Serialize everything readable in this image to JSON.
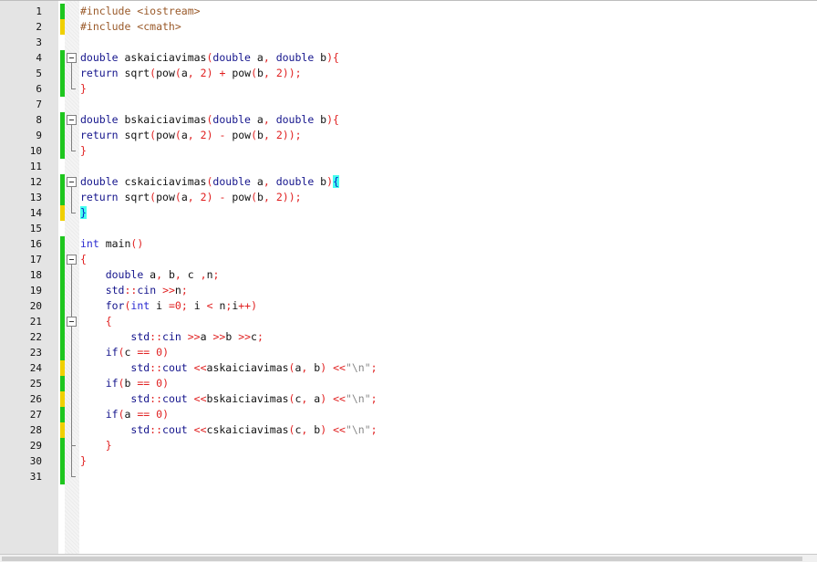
{
  "editor": {
    "lines": [
      {
        "n": "1",
        "change": "green",
        "fold": "none",
        "tokens": [
          [
            "pre",
            "#include <iostream>"
          ]
        ]
      },
      {
        "n": "2",
        "change": "yellow",
        "fold": "none",
        "tokens": [
          [
            "pre",
            "#include <cmath>"
          ]
        ]
      },
      {
        "n": "3",
        "change": "none",
        "fold": "none",
        "tokens": []
      },
      {
        "n": "4",
        "change": "green",
        "fold": "start",
        "tokens": [
          [
            "kw",
            "double"
          ],
          [
            "id",
            " askaiciavimas"
          ],
          [
            "op",
            "("
          ],
          [
            "kw",
            "double"
          ],
          [
            "id",
            " a"
          ],
          [
            "op",
            ","
          ],
          [
            "id",
            " "
          ],
          [
            "kw",
            "double"
          ],
          [
            "id",
            " b"
          ],
          [
            "op",
            "){"
          ]
        ]
      },
      {
        "n": "5",
        "change": "green",
        "fold": "line",
        "tokens": [
          [
            "kw",
            "return"
          ],
          [
            "id",
            " sqrt"
          ],
          [
            "op",
            "("
          ],
          [
            "id",
            "pow"
          ],
          [
            "op",
            "("
          ],
          [
            "id",
            "a"
          ],
          [
            "op",
            ","
          ],
          [
            "id",
            " "
          ],
          [
            "num",
            "2"
          ],
          [
            "op",
            ")"
          ],
          [
            "id",
            " "
          ],
          [
            "op",
            "+"
          ],
          [
            "id",
            " pow"
          ],
          [
            "op",
            "("
          ],
          [
            "id",
            "b"
          ],
          [
            "op",
            ","
          ],
          [
            "id",
            " "
          ],
          [
            "num",
            "2"
          ],
          [
            "op",
            "));"
          ]
        ]
      },
      {
        "n": "6",
        "change": "green",
        "fold": "end",
        "tokens": [
          [
            "op",
            "}"
          ]
        ]
      },
      {
        "n": "7",
        "change": "none",
        "fold": "none",
        "tokens": []
      },
      {
        "n": "8",
        "change": "green",
        "fold": "start",
        "tokens": [
          [
            "kw",
            "double"
          ],
          [
            "id",
            " bskaiciavimas"
          ],
          [
            "op",
            "("
          ],
          [
            "kw",
            "double"
          ],
          [
            "id",
            " a"
          ],
          [
            "op",
            ","
          ],
          [
            "id",
            " "
          ],
          [
            "kw",
            "double"
          ],
          [
            "id",
            " b"
          ],
          [
            "op",
            "){"
          ]
        ]
      },
      {
        "n": "9",
        "change": "green",
        "fold": "line",
        "tokens": [
          [
            "kw",
            "return"
          ],
          [
            "id",
            " sqrt"
          ],
          [
            "op",
            "("
          ],
          [
            "id",
            "pow"
          ],
          [
            "op",
            "("
          ],
          [
            "id",
            "a"
          ],
          [
            "op",
            ","
          ],
          [
            "id",
            " "
          ],
          [
            "num",
            "2"
          ],
          [
            "op",
            ")"
          ],
          [
            "id",
            " "
          ],
          [
            "op",
            "-"
          ],
          [
            "id",
            " pow"
          ],
          [
            "op",
            "("
          ],
          [
            "id",
            "b"
          ],
          [
            "op",
            ","
          ],
          [
            "id",
            " "
          ],
          [
            "num",
            "2"
          ],
          [
            "op",
            "));"
          ]
        ]
      },
      {
        "n": "10",
        "change": "green",
        "fold": "end",
        "tokens": [
          [
            "op",
            "}"
          ]
        ]
      },
      {
        "n": "11",
        "change": "none",
        "fold": "none",
        "tokens": []
      },
      {
        "n": "12",
        "change": "green",
        "fold": "start",
        "tokens": [
          [
            "kw",
            "double"
          ],
          [
            "id",
            " cskaiciavimas"
          ],
          [
            "op",
            "("
          ],
          [
            "kw",
            "double"
          ],
          [
            "id",
            " a"
          ],
          [
            "op",
            ","
          ],
          [
            "id",
            " "
          ],
          [
            "kw",
            "double"
          ],
          [
            "id",
            " b"
          ],
          [
            "op",
            ")"
          ],
          [
            "hl",
            "{"
          ]
        ]
      },
      {
        "n": "13",
        "change": "green",
        "fold": "line",
        "tokens": [
          [
            "kw",
            "return"
          ],
          [
            "id",
            " sqrt"
          ],
          [
            "op",
            "("
          ],
          [
            "id",
            "pow"
          ],
          [
            "op",
            "("
          ],
          [
            "id",
            "a"
          ],
          [
            "op",
            ","
          ],
          [
            "id",
            " "
          ],
          [
            "num",
            "2"
          ],
          [
            "op",
            ")"
          ],
          [
            "id",
            " "
          ],
          [
            "op",
            "-"
          ],
          [
            "id",
            " pow"
          ],
          [
            "op",
            "("
          ],
          [
            "id",
            "b"
          ],
          [
            "op",
            ","
          ],
          [
            "id",
            " "
          ],
          [
            "num",
            "2"
          ],
          [
            "op",
            "));"
          ]
        ]
      },
      {
        "n": "14",
        "change": "yellow",
        "fold": "end",
        "tokens": [
          [
            "hl",
            "}"
          ]
        ]
      },
      {
        "n": "15",
        "change": "none",
        "fold": "none",
        "tokens": []
      },
      {
        "n": "16",
        "change": "green",
        "fold": "none",
        "tokens": [
          [
            "tp",
            "int"
          ],
          [
            "id",
            " main"
          ],
          [
            "op",
            "()"
          ]
        ]
      },
      {
        "n": "17",
        "change": "green",
        "fold": "start",
        "tokens": [
          [
            "op",
            "{"
          ]
        ]
      },
      {
        "n": "18",
        "change": "green",
        "fold": "line",
        "tokens": [
          [
            "id",
            "    "
          ],
          [
            "kw",
            "double"
          ],
          [
            "id",
            " a"
          ],
          [
            "op",
            ","
          ],
          [
            "id",
            " b"
          ],
          [
            "op",
            ","
          ],
          [
            "id",
            " c "
          ],
          [
            "op",
            ","
          ],
          [
            "id",
            "n"
          ],
          [
            "op",
            ";"
          ]
        ]
      },
      {
        "n": "19",
        "change": "green",
        "fold": "line",
        "tokens": [
          [
            "id",
            "    "
          ],
          [
            "kw",
            "std"
          ],
          [
            "op",
            "::"
          ],
          [
            "kw",
            "cin"
          ],
          [
            "id",
            " "
          ],
          [
            "op",
            ">>"
          ],
          [
            "id",
            "n"
          ],
          [
            "op",
            ";"
          ]
        ]
      },
      {
        "n": "20",
        "change": "green",
        "fold": "line",
        "tokens": [
          [
            "id",
            "    "
          ],
          [
            "kw",
            "for"
          ],
          [
            "op",
            "("
          ],
          [
            "tp",
            "int"
          ],
          [
            "id",
            " i "
          ],
          [
            "op",
            "="
          ],
          [
            "num",
            "0"
          ],
          [
            "op",
            ";"
          ],
          [
            "id",
            " i "
          ],
          [
            "op",
            "<"
          ],
          [
            "id",
            " n"
          ],
          [
            "op",
            ";"
          ],
          [
            "id",
            "i"
          ],
          [
            "op",
            "++)"
          ]
        ]
      },
      {
        "n": "21",
        "change": "green",
        "fold": "inner-start",
        "tokens": [
          [
            "id",
            "    "
          ],
          [
            "op",
            "{"
          ]
        ]
      },
      {
        "n": "22",
        "change": "green",
        "fold": "line",
        "tokens": [
          [
            "id",
            "        "
          ],
          [
            "kw",
            "std"
          ],
          [
            "op",
            "::"
          ],
          [
            "kw",
            "cin"
          ],
          [
            "id",
            " "
          ],
          [
            "op",
            ">>"
          ],
          [
            "id",
            "a "
          ],
          [
            "op",
            ">>"
          ],
          [
            "id",
            "b "
          ],
          [
            "op",
            ">>"
          ],
          [
            "id",
            "c"
          ],
          [
            "op",
            ";"
          ]
        ]
      },
      {
        "n": "23",
        "change": "green",
        "fold": "line",
        "tokens": [
          [
            "id",
            "    "
          ],
          [
            "kw",
            "if"
          ],
          [
            "op",
            "("
          ],
          [
            "id",
            "c "
          ],
          [
            "op",
            "=="
          ],
          [
            "id",
            " "
          ],
          [
            "num",
            "0"
          ],
          [
            "op",
            ")"
          ]
        ]
      },
      {
        "n": "24",
        "change": "yellow",
        "fold": "line",
        "tokens": [
          [
            "id",
            "        "
          ],
          [
            "kw",
            "std"
          ],
          [
            "op",
            "::"
          ],
          [
            "kw",
            "cout"
          ],
          [
            "id",
            " "
          ],
          [
            "op",
            "<<"
          ],
          [
            "id",
            "askaiciavimas"
          ],
          [
            "op",
            "("
          ],
          [
            "id",
            "a"
          ],
          [
            "op",
            ","
          ],
          [
            "id",
            " b"
          ],
          [
            "op",
            ")"
          ],
          [
            "id",
            " "
          ],
          [
            "op",
            "<<"
          ],
          [
            "str",
            "\"\\n\""
          ],
          [
            "op",
            ";"
          ]
        ]
      },
      {
        "n": "25",
        "change": "green",
        "fold": "line",
        "tokens": [
          [
            "id",
            "    "
          ],
          [
            "kw",
            "if"
          ],
          [
            "op",
            "("
          ],
          [
            "id",
            "b "
          ],
          [
            "op",
            "=="
          ],
          [
            "id",
            " "
          ],
          [
            "num",
            "0"
          ],
          [
            "op",
            ")"
          ]
        ]
      },
      {
        "n": "26",
        "change": "yellow",
        "fold": "line",
        "tokens": [
          [
            "id",
            "        "
          ],
          [
            "kw",
            "std"
          ],
          [
            "op",
            "::"
          ],
          [
            "kw",
            "cout"
          ],
          [
            "id",
            " "
          ],
          [
            "op",
            "<<"
          ],
          [
            "id",
            "bskaiciavimas"
          ],
          [
            "op",
            "("
          ],
          [
            "id",
            "c"
          ],
          [
            "op",
            ","
          ],
          [
            "id",
            " a"
          ],
          [
            "op",
            ")"
          ],
          [
            "id",
            " "
          ],
          [
            "op",
            "<<"
          ],
          [
            "str",
            "\"\\n\""
          ],
          [
            "op",
            ";"
          ]
        ]
      },
      {
        "n": "27",
        "change": "green",
        "fold": "line",
        "tokens": [
          [
            "id",
            "    "
          ],
          [
            "kw",
            "if"
          ],
          [
            "op",
            "("
          ],
          [
            "id",
            "a "
          ],
          [
            "op",
            "=="
          ],
          [
            "id",
            " "
          ],
          [
            "num",
            "0"
          ],
          [
            "op",
            ")"
          ]
        ]
      },
      {
        "n": "28",
        "change": "yellow",
        "fold": "line",
        "tokens": [
          [
            "id",
            "        "
          ],
          [
            "kw",
            "std"
          ],
          [
            "op",
            "::"
          ],
          [
            "kw",
            "cout"
          ],
          [
            "id",
            " "
          ],
          [
            "op",
            "<<"
          ],
          [
            "id",
            "cskaiciavimas"
          ],
          [
            "op",
            "("
          ],
          [
            "id",
            "c"
          ],
          [
            "op",
            ","
          ],
          [
            "id",
            " b"
          ],
          [
            "op",
            ")"
          ],
          [
            "id",
            " "
          ],
          [
            "op",
            "<<"
          ],
          [
            "str",
            "\"\\n\""
          ],
          [
            "op",
            ";"
          ]
        ]
      },
      {
        "n": "29",
        "change": "green",
        "fold": "inner-end",
        "tokens": [
          [
            "id",
            "    "
          ],
          [
            "op",
            "}"
          ]
        ]
      },
      {
        "n": "30",
        "change": "green",
        "fold": "line",
        "tokens": [
          [
            "op",
            "}"
          ]
        ]
      },
      {
        "n": "31",
        "change": "green",
        "fold": "end",
        "tokens": []
      }
    ]
  },
  "colors": {
    "gutter_bg": "#e4e4e4",
    "change_saved": "#1ec61e",
    "change_modified": "#f0d000",
    "keyword": "#14148c",
    "type_keyword": "#2a2ad0",
    "operator": "#e02020",
    "number": "#e02020",
    "preprocessor": "#9a5a2a",
    "brace_match_bg": "#44ffee"
  }
}
